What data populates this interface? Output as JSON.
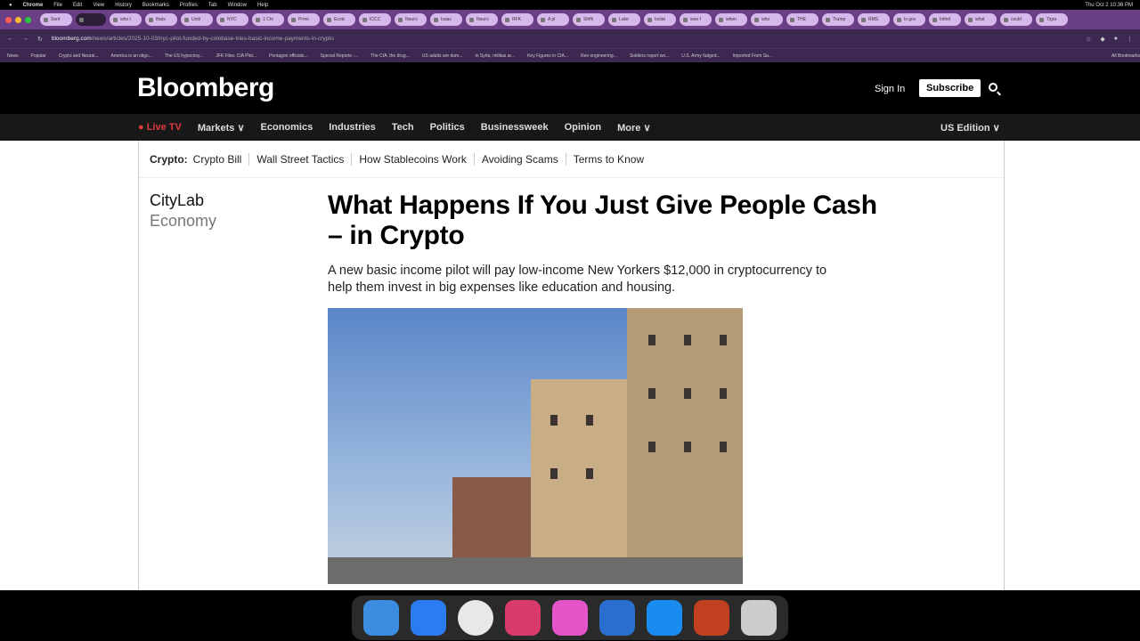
{
  "menubar": {
    "apple": "",
    "items": [
      "Chrome",
      "File",
      "Edit",
      "View",
      "History",
      "Bookmarks",
      "Profiles",
      "Tab",
      "Window",
      "Help"
    ],
    "clock": "Thu Oct 2  10:36 PM"
  },
  "tabs": [
    "Sent",
    "",
    "who t",
    "thats",
    "Uniti",
    "NYC",
    "1 Chr",
    "Prmo",
    "Ecotc",
    "ICCC",
    "Neuro",
    "Isaac",
    "Neuro",
    "RFK",
    "A pl",
    "Shifti",
    "Luke",
    "Isolat",
    "wee f",
    "when",
    "who",
    "THE",
    "Trump",
    "RMS",
    "Is gov",
    "Infinit",
    "what",
    "could",
    "Tigra"
  ],
  "address": {
    "domain": "bloomberg.com",
    "path": "/news/articles/2025-10-03/nyc-pilot-funded-by-coinbase-tries-basic-income-payments-in-crypto"
  },
  "bookmarks": [
    "News",
    "Popular",
    "Crypto and Neural...",
    "America is an oligo...",
    "The US hypocrisy...",
    "JFK Files: CIA Plot...",
    "Pentagon officials...",
    "Special Reports -...",
    "The CIA, the drug...",
    "US adults are dum...",
    "In Syria, militias ar...",
    "Key Figures in CIA...",
    "Reo engineering...",
    "Soldiers report wo...",
    "U.S. Army fudged...",
    "Imported From Sa...",
    "All Bookmarks"
  ],
  "header": {
    "logo": "Bloomberg",
    "sign_in": "Sign In",
    "subscribe": "Subscribe"
  },
  "nav": {
    "live": "Live TV",
    "items": [
      "Markets ∨",
      "Economics",
      "Industries",
      "Tech",
      "Politics",
      "Businessweek",
      "Opinion",
      "More ∨"
    ],
    "edition": "US Edition ∨"
  },
  "subnav": {
    "lead": "Crypto:",
    "items": [
      "Crypto Bill",
      "Wall Street Tactics",
      "How Stablecoins Work",
      "Avoiding Scams",
      "Terms to Know"
    ]
  },
  "article": {
    "section": "CityLab",
    "subsection": "Economy",
    "title": "What Happens If You Just Give People Cash – in Crypto",
    "dek": "A new basic income pilot will pay low-income New Yorkers $12,000 in cryptocurrency to help them invest in big expenses like education and housing."
  },
  "dock": [
    "Finder",
    "Safari",
    "Chrome",
    "Notes",
    "Keynote",
    "QuickTime",
    "App Store",
    "Preview",
    "Trash"
  ]
}
